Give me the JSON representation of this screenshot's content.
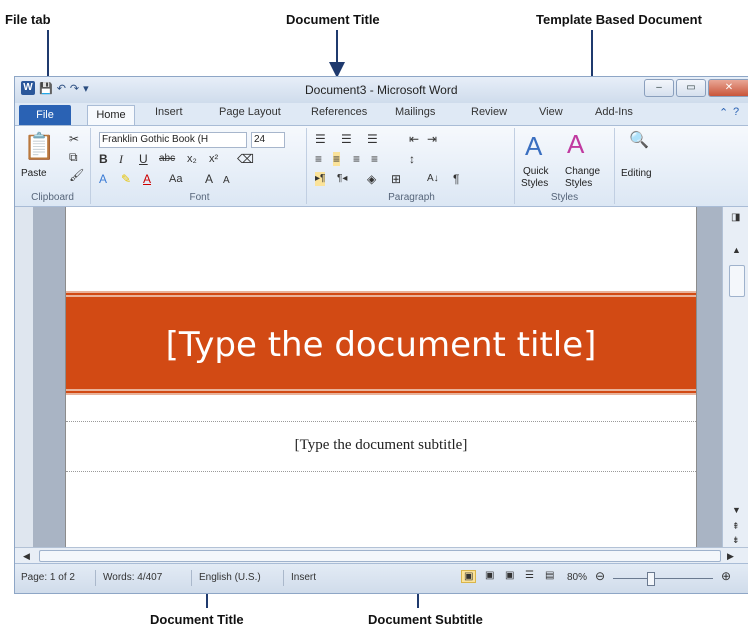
{
  "annotations": {
    "file_tab": "File tab",
    "document_title_top": "Document Title",
    "template_based_document": "Template Based Document",
    "document_title_bottom": "Document Title",
    "document_subtitle": "Document Subtitle"
  },
  "window": {
    "title": "Document3 - Microsoft Word",
    "qat_undo": "↶",
    "qat_redo": "↷"
  },
  "tabs": [
    "File",
    "Home",
    "Insert",
    "Page Layout",
    "References",
    "Mailings",
    "Review",
    "View",
    "Add-Ins"
  ],
  "ribbon": {
    "clipboard": {
      "paste": "Paste",
      "label": "Clipboard"
    },
    "font": {
      "name": "Franklin Gothic Book (H",
      "size": "24",
      "label": "Font",
      "bold": "B",
      "italic": "I",
      "underline": "U",
      "strike": "abc",
      "subscript": "x₂",
      "superscript": "x²",
      "grow": "A",
      "shrink": "A",
      "case": "Aa"
    },
    "paragraph": {
      "label": "Paragraph",
      "pilcrow": "¶",
      "sort": "A↓"
    },
    "styles": {
      "quick": "Quick",
      "styles1": "Styles",
      "change": "Change",
      "styles2": "Styles",
      "label": "Styles"
    },
    "editing": {
      "label": "Editing"
    }
  },
  "document": {
    "title_placeholder": "[Type the document title]",
    "subtitle_placeholder": "[Type the document subtitle]"
  },
  "status": {
    "page": "Page: 1 of 2",
    "words": "Words: 4/407",
    "language": "English (U.S.)",
    "mode": "Insert",
    "zoom": "80%"
  },
  "colors": {
    "title_band": "#d24a14",
    "file_tab": "#2a62b4",
    "annotation_arrow": "#1f3a6e"
  }
}
